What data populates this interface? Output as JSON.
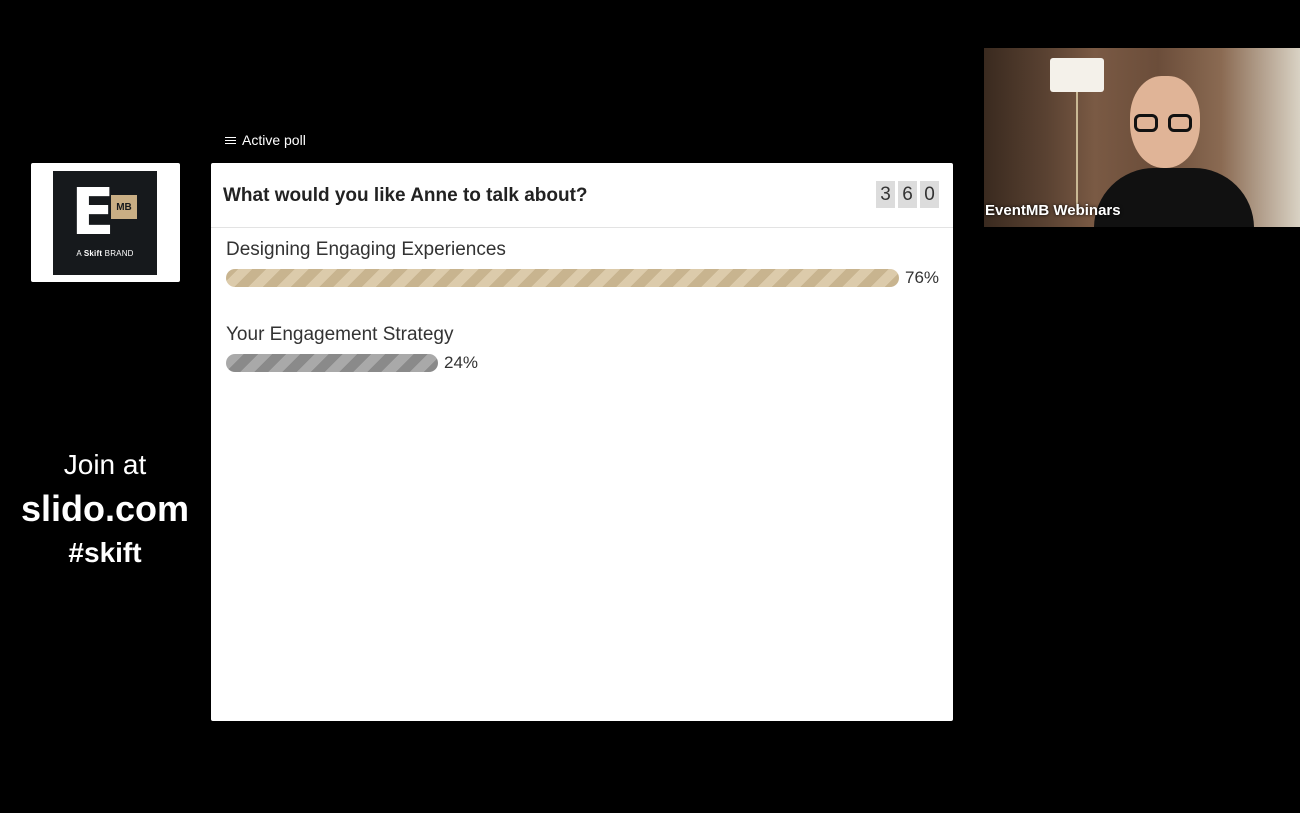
{
  "logo": {
    "letter": "E",
    "badge": "MB",
    "tagline_prefix": "A",
    "tagline_brand": "Skift",
    "tagline_suffix": "BRAND"
  },
  "join": {
    "line1": "Join at",
    "line2": "slido.com",
    "line3": "#skift"
  },
  "poll": {
    "section_label": "Active poll",
    "question": "What would you like Anne to talk about?",
    "vote_count_digits": [
      "3",
      "6",
      "0"
    ],
    "options": [
      {
        "label": "Designing Engaging Experiences",
        "percent_text": "76%",
        "fraction": 0.76,
        "color": "#c8b48f"
      },
      {
        "label": "Your Engagement Strategy",
        "percent_text": "24%",
        "fraction": 0.24,
        "color": "#8a8a8a"
      }
    ]
  },
  "video": {
    "participant_name": "EventMB Webinars"
  },
  "icons": {
    "section": "list-icon"
  }
}
